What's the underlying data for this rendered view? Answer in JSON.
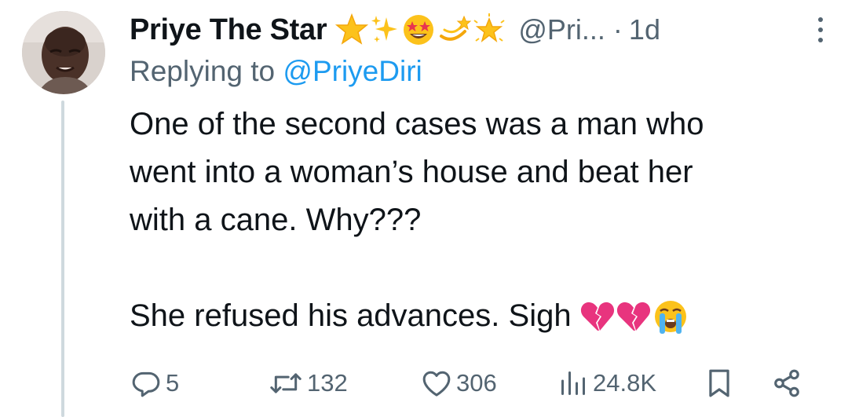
{
  "tweet": {
    "author": {
      "display_name": "Priye The Star",
      "handle": "@Pri...",
      "name_emojis": [
        "star-emoji",
        "sparkles-emoji",
        "star-struck-emoji",
        "dizzy-emoji",
        "glowing-star-emoji"
      ]
    },
    "separator": "·",
    "time": "1d",
    "replying_to": {
      "prefix": "Replying to",
      "mention": "@PriyeDiri"
    },
    "body": {
      "line1": "One of the second cases was a man who",
      "line2": "went into a woman’s house and beat her",
      "line3": "with a cane. Why???",
      "line4": "She refused his advances. Sigh",
      "trailing_emojis": [
        "broken-heart-emoji",
        "broken-heart-emoji",
        "loudly-crying-face-emoji"
      ]
    },
    "actions": {
      "replies": "5",
      "reposts": "132",
      "likes": "306",
      "views": "24.8K"
    }
  },
  "colors": {
    "text": "#0f1419",
    "secondary": "#536471",
    "link": "#1d9bf0",
    "thread_line": "#cfd9de"
  }
}
